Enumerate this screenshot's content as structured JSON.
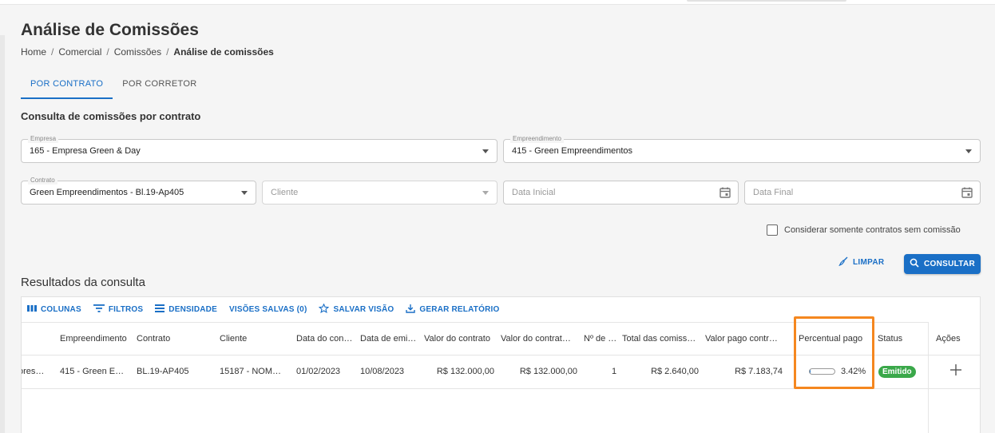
{
  "header": {
    "title": "Análise de Comissões",
    "breadcrumb": [
      "Home",
      "Comercial",
      "Comissões",
      "Análise de comissões"
    ],
    "breadcrumb_sep": "/"
  },
  "tabs": [
    {
      "label": "POR CONTRATO",
      "active": true
    },
    {
      "label": "POR CORRETOR",
      "active": false
    }
  ],
  "form": {
    "title": "Consulta de comissões por contrato",
    "empresa": {
      "label": "Empresa",
      "value": "165 - Empresa Green & Day"
    },
    "empreendimento": {
      "label": "Empreendimento",
      "value": "415 - Green Empreendimentos"
    },
    "contrato": {
      "label": "Contrato",
      "value": "Green Empreendimentos - Bl.19-Ap405"
    },
    "cliente": {
      "placeholder": "Cliente"
    },
    "data_inicial": {
      "placeholder": "Data Inicial"
    },
    "data_final": {
      "placeholder": "Data Final"
    },
    "checkbox_label": "Considerar somente contratos sem comissão",
    "checkbox_checked": false,
    "limpar_label": "LIMPAR",
    "consultar_label": "CONSULTAR"
  },
  "results": {
    "title": "Resultados da consulta",
    "toolbar": {
      "colunas": "COLUNAS",
      "filtros": "FILTROS",
      "densidade": "DENSIDADE",
      "visoes": "VISÕES SALVAS (0)",
      "salvar": "SALVAR VISÃO",
      "relatorio": "GERAR RELATÓRIO"
    },
    "columns": {
      "empreendimento": "Empreendimento",
      "contrato": "Contrato",
      "cliente": "Cliente",
      "data_contrato": "Data do con…",
      "data_emissao": "Data de emi…",
      "valor_contrato": "Valor do contrato",
      "valor_contrato2": "Valor do contrat…",
      "numero": "Nº de …",
      "total_comissoes": "Total das comiss…",
      "valor_pago": "Valor pago contr…",
      "percentual": "Percentual pago",
      "status": "Status",
      "acoes": "Ações"
    },
    "rows": [
      {
        "empresa": "ores…",
        "empreendimento": "415 - Green E…",
        "contrato": "BL.19-AP405",
        "cliente": "15187 - NOM…",
        "data_contrato": "01/02/2023",
        "data_emissao": "10/08/2023",
        "valor_contrato": "R$ 132.000,00",
        "valor_contrato2": "R$ 132.000,00",
        "numero": "1",
        "total_comissoes": "R$ 2.640,00",
        "valor_pago": "R$ 7.183,74",
        "percentual_value": 3.42,
        "percentual": "3.42%",
        "status": "Emitido"
      }
    ]
  },
  "colors": {
    "primary": "#1a6fc6",
    "status_emitido": "#3aa84a",
    "highlight": "#f5871f"
  }
}
